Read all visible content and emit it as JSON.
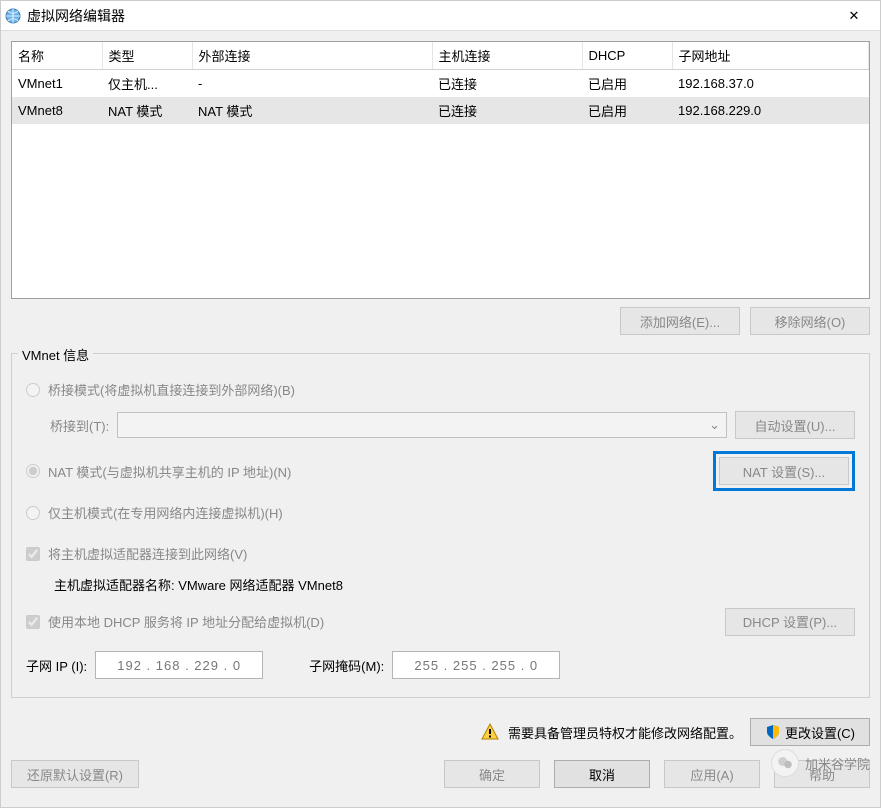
{
  "window": {
    "title": "虚拟网络编辑器"
  },
  "table": {
    "headers": {
      "name": "名称",
      "type": "类型",
      "external": "外部连接",
      "host": "主机连接",
      "dhcp": "DHCP",
      "subnet": "子网地址"
    },
    "rows": [
      {
        "name": "VMnet1",
        "type": "仅主机...",
        "external": "-",
        "host": "已连接",
        "dhcp": "已启用",
        "subnet": "192.168.37.0"
      },
      {
        "name": "VMnet8",
        "type": "NAT 模式",
        "external": "NAT 模式",
        "host": "已连接",
        "dhcp": "已启用",
        "subnet": "192.168.229.0"
      }
    ]
  },
  "buttons": {
    "add_network": "添加网络(E)...",
    "remove_network": "移除网络(O)",
    "auto_settings": "自动设置(U)...",
    "nat_settings": "NAT 设置(S)...",
    "dhcp_settings": "DHCP 设置(P)...",
    "change_settings": "更改设置(C)",
    "restore_defaults": "还原默认设置(R)",
    "ok": "确定",
    "cancel": "取消",
    "apply": "应用(A)",
    "help": "帮助"
  },
  "groupbox": {
    "legend": "VMnet 信息",
    "bridged_label": "桥接模式(将虚拟机直接连接到外部网络)(B)",
    "bridged_to_label": "桥接到(T):",
    "nat_label": "NAT 模式(与虚拟机共享主机的 IP 地址)(N)",
    "hostonly_label": "仅主机模式(在专用网络内连接虚拟机)(H)",
    "connect_host_adapter": "将主机虚拟适配器连接到此网络(V)",
    "host_adapter_name_label": "主机虚拟适配器名称: VMware 网络适配器 VMnet8",
    "use_local_dhcp": "使用本地 DHCP 服务将 IP 地址分配给虚拟机(D)",
    "subnet_ip_label": "子网 IP (I):",
    "subnet_ip_value": "192 . 168 . 229 .  0",
    "subnet_mask_label": "子网掩码(M):",
    "subnet_mask_value": "255 . 255 . 255 .  0"
  },
  "admin_notice": "需要具备管理员特权才能修改网络配置。",
  "watermark": "加米谷学院"
}
